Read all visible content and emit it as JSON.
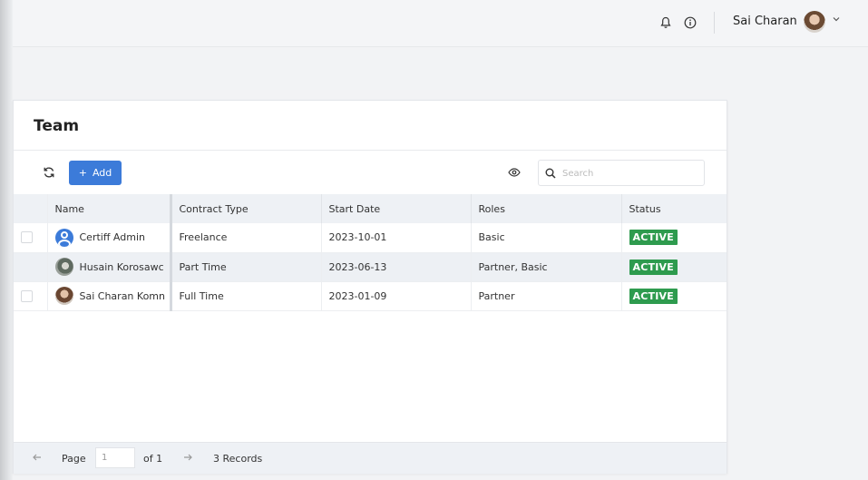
{
  "header": {
    "user_name": "Sai Charan",
    "icons": [
      "bell-icon",
      "info-icon",
      "chevron-down-icon"
    ]
  },
  "card": {
    "title": "Team",
    "add_label": "Add",
    "search_placeholder": "Search"
  },
  "table": {
    "columns": [
      "Name",
      "Contract Type",
      "Start Date",
      "Roles",
      "Status"
    ],
    "rows": [
      {
        "name": "Certiff Admin",
        "contract": "Freelance",
        "start": "2023-10-01",
        "roles": "Basic",
        "status": "ACTIVE"
      },
      {
        "name": "Husain Korosawc",
        "contract": "Part Time",
        "start": "2023-06-13",
        "roles": "Partner, Basic",
        "status": "ACTIVE"
      },
      {
        "name": "Sai Charan Komn",
        "contract": "Full Time",
        "start": "2023-01-09",
        "roles": "Partner",
        "status": "ACTIVE"
      }
    ]
  },
  "footer": {
    "page_label": "Page",
    "page_value": "1",
    "of_label": "of 1",
    "records": "3 Records"
  },
  "colors": {
    "accent": "#3c7bd9",
    "active_badge": "#2e9b4e"
  }
}
